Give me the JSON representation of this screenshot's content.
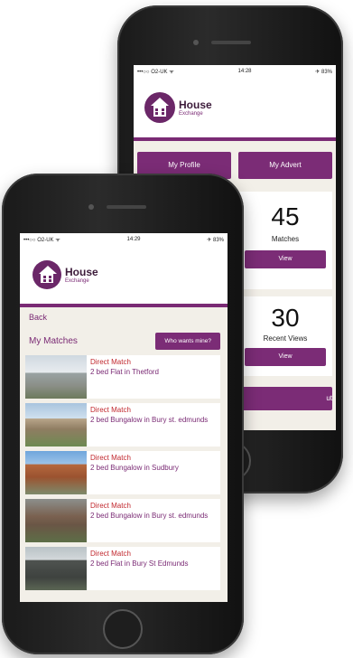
{
  "back_phone": {
    "status": {
      "carrier": "•••○○ O2-UK ᯤ",
      "time": "14:28",
      "battery": "✈ 83%"
    },
    "logo": {
      "title": "House",
      "subtitle": "Exchange"
    },
    "buttons": {
      "my_profile": "My Profile",
      "my_advert": "My Advert"
    },
    "matches_tile": {
      "count": "45",
      "label": "Matches",
      "view": "View"
    },
    "recent_tile": {
      "count": "30",
      "label": "Recent Views",
      "view": "View"
    },
    "bottom_button": "ut"
  },
  "front_phone": {
    "status": {
      "carrier": "•••○○ O2-UK ᯤ",
      "time": "14:29",
      "battery": "✈ 83%"
    },
    "logo": {
      "title": "House",
      "subtitle": "Exchange"
    },
    "back_label": "Back",
    "matches_title": "My Matches",
    "who_wants_button": "Who wants mine?",
    "matches": [
      {
        "type": "Direct Match",
        "desc": "2 bed Flat in Thetford"
      },
      {
        "type": "Direct Match",
        "desc": "2 bed Bungalow in Bury st. edmunds"
      },
      {
        "type": "Direct Match",
        "desc": "2 bed Bungalow in Sudbury"
      },
      {
        "type": "Direct Match",
        "desc": "2 bed Bungalow in Bury st. edmunds"
      },
      {
        "type": "Direct Match",
        "desc": "2 bed Flat in Bury St Edmunds"
      }
    ]
  },
  "colors": {
    "brand_purple": "#7b2c76",
    "match_red": "#c1272d",
    "screen_bg": "#f2efe8"
  }
}
